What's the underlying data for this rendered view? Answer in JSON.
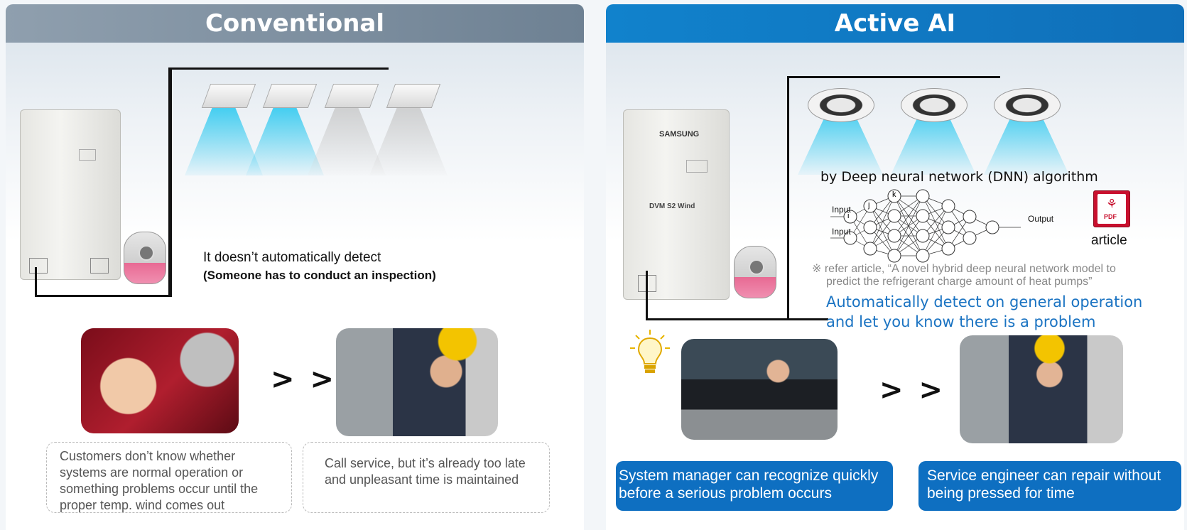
{
  "left": {
    "title": "Conventional",
    "detect_text": "It doesn’t automatically detect",
    "inspect_text": "(Someone has to conduct an inspection)",
    "arrow": "> >",
    "caption_customers": "Customers don’t know whether systems are normal operation or something problems occur until the proper temp. wind comes out",
    "caption_service": "Call service, but it’s already too late and unpleasant time is maintained"
  },
  "right": {
    "title": "Active AI",
    "dnn_title": "by Deep neural network (DNN) algorithm",
    "input1": "Input",
    "input2": "Input",
    "output": "Output",
    "node_i": "i",
    "node_j": "j",
    "node_k": "k",
    "pdf_label": "PDF",
    "article_label": "article",
    "ref_line1": "※ refer article, “A novel hybrid deep neural network model to",
    "ref_line2": "predict the refrigerant charge amount of heat pumps”",
    "auto_line1": "Automatically detect on general operation",
    "auto_line2": "and let you know there is a problem",
    "brand": "SAMSUNG",
    "model": "DVM S2  Wind",
    "arrow": "> >",
    "box_manager": "System manager can recognize quickly before a serious problem occurs",
    "box_engineer": "Service engineer can repair without being pressed for time"
  },
  "colors": {
    "conventional_header": "#7b8d9e",
    "active_header": "#1182cc",
    "blue_box": "#0e6fc1",
    "blue_text": "#1a73c2"
  }
}
